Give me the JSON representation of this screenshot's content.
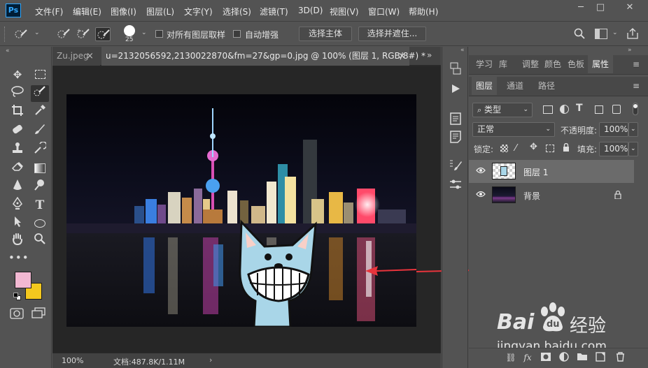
{
  "app": {
    "logo": "Ps",
    "menu": [
      "文件(F)",
      "编辑(E)",
      "图像(I)",
      "图层(L)",
      "文字(Y)",
      "选择(S)",
      "滤镜(T)",
      "3D(D)",
      "视图(V)",
      "窗口(W)",
      "帮助(H)"
    ],
    "window_controls": {
      "minimize": "─",
      "maximize": "□",
      "close": "✕"
    }
  },
  "options": {
    "brush_size": "25",
    "sample_all_layers": "对所有图层取样",
    "auto_enhance": "自动增强",
    "select_subject": "选择主体",
    "select_and_mask": "选择并遮住..."
  },
  "document": {
    "tabs": [
      {
        "label": "Zu.jpeg",
        "close": "×",
        "active": false
      },
      {
        "label": "u=2132056592,2130022870&fm=27&gp=0.jpg @ 100% (图层 1, RGB/8#) *",
        "close": "×",
        "active": true
      }
    ],
    "zoom": "100%",
    "doc_info": "文档:487.8K/1.11M",
    "status_arrow": "›"
  },
  "panels": {
    "top_tabs": [
      "学习",
      "库",
      "调整",
      "颜色",
      "色板",
      "属性"
    ],
    "active_top_tab": "属性",
    "layer_tabs": [
      "图层",
      "通道",
      "路径"
    ],
    "filter_kind": "类型",
    "blend_mode": "正常",
    "opacity_label": "不透明度:",
    "opacity_value": "100%",
    "lock_label": "锁定:",
    "fill_label": "填充:",
    "fill_value": "100%",
    "layers": [
      {
        "name": "图层 1",
        "selected": true,
        "locked": false
      },
      {
        "name": "背景",
        "selected": false,
        "locked": true
      }
    ]
  },
  "colors": {
    "foreground": "#f2b8d2",
    "background": "#f4c81e",
    "arrow": "#e8343c",
    "selected_layer": "#6b6b6b"
  },
  "watermark": {
    "brand": "Bai",
    "paw": "du",
    "cn": "经验",
    "url": "jingyan.baidu.com"
  }
}
